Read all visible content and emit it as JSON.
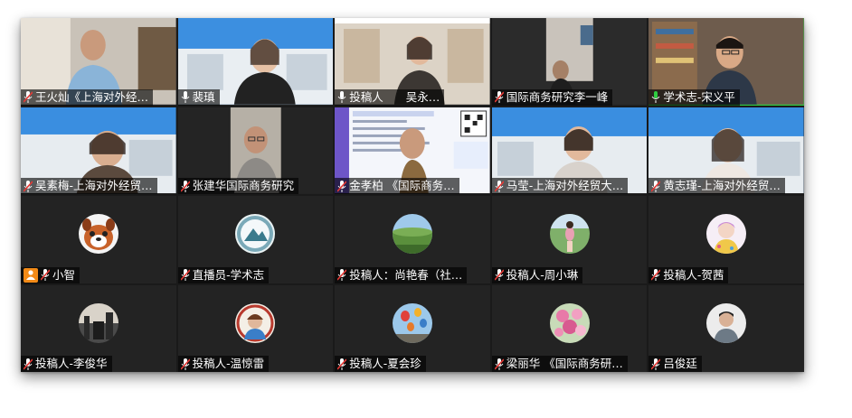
{
  "participants": [
    {
      "name": "王火灿《上海对外经…",
      "mic": "muted"
    },
    {
      "name": "裴瑱",
      "mic": "on"
    },
    {
      "name": "投稿人　　吴永…",
      "mic": "on"
    },
    {
      "name": "国际商务研究李一峰",
      "mic": "muted"
    },
    {
      "name": "学术志-宋义平",
      "mic": "on",
      "active": true
    },
    {
      "name": "吴素梅-上海对外经贸…",
      "mic": "muted"
    },
    {
      "name": "张建华国际商务研究",
      "mic": "muted"
    },
    {
      "name": "金孝柏 《国际商务…",
      "mic": "muted"
    },
    {
      "name": "马莹-上海对外经贸大…",
      "mic": "muted"
    },
    {
      "name": "黄志瑾-上海对外经贸…",
      "mic": "muted"
    },
    {
      "name": "小智",
      "mic": "muted",
      "host": true
    },
    {
      "name": "直播员-学术志",
      "mic": "muted"
    },
    {
      "name": "投稿人：尚艳春（社…",
      "mic": "muted"
    },
    {
      "name": "投稿人-周小琳",
      "mic": "muted"
    },
    {
      "name": "投稿人-贺茜",
      "mic": "muted"
    },
    {
      "name": "投稿人-李俊华",
      "mic": "muted"
    },
    {
      "name": "投稿人-温惊雷",
      "mic": "muted"
    },
    {
      "name": "投稿人-夏会珍",
      "mic": "muted"
    },
    {
      "name": "梁丽华 《国际商务研…",
      "mic": "muted"
    },
    {
      "name": "吕俊廷",
      "mic": "muted"
    }
  ]
}
